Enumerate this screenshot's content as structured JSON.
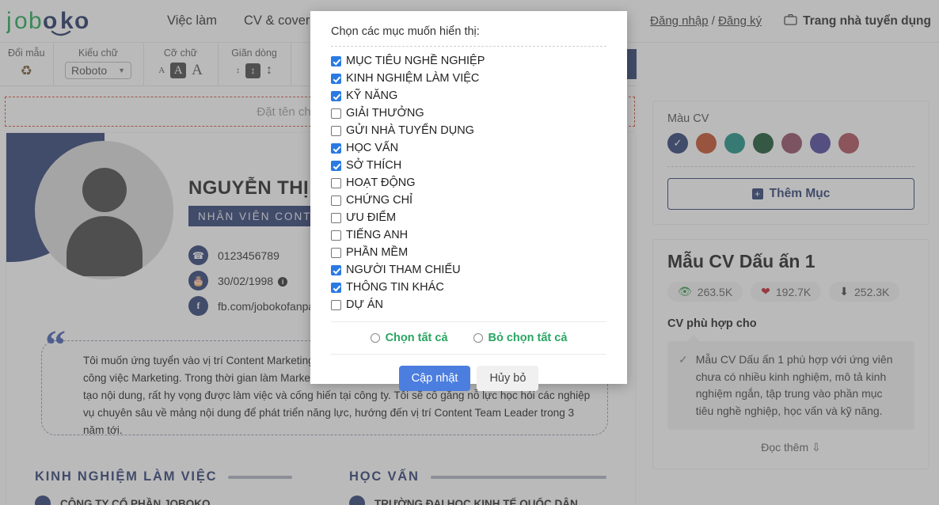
{
  "nav": {
    "logo_text": "joboko",
    "links": [
      {
        "label": "Việc làm"
      },
      {
        "label": "CV & cover letter"
      }
    ],
    "auth_login": "Đăng nhập",
    "auth_sep": "/",
    "auth_register": "Đăng ký",
    "recruiter_label": "Trang nhà tuyển dụng",
    "recruiter_icon": "briefcase-icon"
  },
  "toolbar": {
    "groups": [
      {
        "label": "Đổi mẫu",
        "icon": "recycle-icon"
      },
      {
        "label": "Kiểu chữ",
        "value": "Roboto"
      },
      {
        "label": "Cỡ chữ",
        "small": "A",
        "medium": "A",
        "large": "A"
      },
      {
        "label": "Giãn dòng",
        "small": "↕",
        "medium": "↕",
        "large": "↕"
      }
    ]
  },
  "name_field": {
    "placeholder": "Đặt tên cho CV của bạn"
  },
  "cv": {
    "full_name": "NGUYỄN THỊ THANH",
    "job_title": "NHÂN VIÊN CONTENT MARKETING",
    "contacts": [
      {
        "icon": "phone-icon",
        "text": "0123456789"
      },
      {
        "icon": "cake-icon",
        "text": "30/02/1998",
        "has_info": true
      },
      {
        "icon": "facebook-icon",
        "text": "fb.com/jobokofanpage"
      }
    ],
    "summary": "Tôi muốn ứng tuyển vào vị trí Content Marketing tại công ty. Là một người có niềm đam mê sâu sắc với công việc Marketing. Trong thời gian làm Marketing, tôi đã tích lũy được những kỹ năng nhất định về sáng tạo nội dung, rất hy vọng được làm việc và cống hiến tại công ty. Tôi sẽ cố gắng nỗ lực học hỏi các nghiệp vụ chuyên sâu về mảng nội dung để phát triển năng lực, hướng đến vị trí Content Team Leader trong 3 năm tới.",
    "sections": [
      {
        "title": "KINH NGHIỆM LÀM VIỆC",
        "item": "CÔNG TY CỔ PHẦN JOBOKO"
      },
      {
        "title": "HỌC VẤN",
        "item": "TRƯỜNG ĐẠI HỌC KINH TẾ QUỐC DÂN"
      }
    ]
  },
  "sidebar": {
    "color_label": "Màu CV",
    "colors": [
      {
        "hex": "#20336b",
        "selected": true
      },
      {
        "hex": "#c0441c",
        "selected": false
      },
      {
        "hex": "#0d8a7c",
        "selected": false
      },
      {
        "hex": "#0a4a25",
        "selected": false
      },
      {
        "hex": "#8c445c",
        "selected": false
      },
      {
        "hex": "#413a94",
        "selected": false
      },
      {
        "hex": "#a84551",
        "selected": false
      }
    ],
    "add_section_label": "Thêm Mục",
    "add_section_icon": "plus-square-icon",
    "template_name": "Mẫu CV Dấu ấn 1",
    "stats": [
      {
        "icon": "eye-icon",
        "value": "263.5K",
        "color": "#1e8c3a"
      },
      {
        "icon": "heart-icon",
        "value": "192.7K",
        "color": "#c0121c"
      },
      {
        "icon": "download-icon",
        "value": "252.3K",
        "color": "#333333"
      }
    ],
    "suitable_title": "CV phù hợp cho",
    "suitable_text": "Mẫu CV Dấu ấn 1 phù hợp với ứng viên chưa có nhiều kinh nghiệm, mô tả kinh nghiệm ngắn, tập trung vào phần mục tiêu nghề nghiệp, học vấn và kỹ năng.",
    "read_more": "Đọc thêm"
  },
  "modal": {
    "title": "Chọn các mục muốn hiển thị:",
    "options": [
      {
        "label": "MỤC TIÊU NGHỀ NGHIỆP",
        "checked": true
      },
      {
        "label": "KINH NGHIỆM LÀM VIỆC",
        "checked": true
      },
      {
        "label": "KỸ NĂNG",
        "checked": true
      },
      {
        "label": "GIẢI THƯỞNG",
        "checked": false
      },
      {
        "label": "GỬI NHÀ TUYỂN DỤNG",
        "checked": false
      },
      {
        "label": "HỌC VẤN",
        "checked": true
      },
      {
        "label": "SỞ THÍCH",
        "checked": true
      },
      {
        "label": "HOẠT ĐỘNG",
        "checked": false
      },
      {
        "label": "CHỨNG CHỈ",
        "checked": false
      },
      {
        "label": "ƯU ĐIỂM",
        "checked": false
      },
      {
        "label": "TIẾNG ANH",
        "checked": false
      },
      {
        "label": "PHẦN MỀM",
        "checked": false
      },
      {
        "label": "NGƯỜI THAM CHIẾU",
        "checked": true
      },
      {
        "label": "THÔNG TIN KHÁC",
        "checked": true
      },
      {
        "label": "DỰ ÁN",
        "checked": false
      }
    ],
    "select_all": "Chọn tất cả",
    "deselect_all": "Bỏ chọn tất cả",
    "update_button": "Cập nhật",
    "cancel_button": "Hủy bỏ",
    "accent_color": "#4c7ee0",
    "radio_color": "#2aa563"
  }
}
